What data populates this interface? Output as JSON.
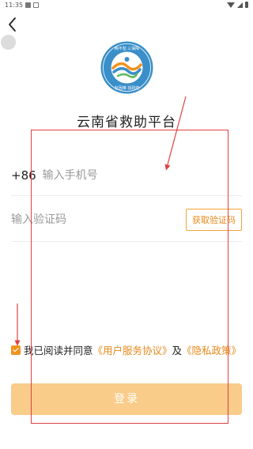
{
  "status_bar": {
    "time": "11:35"
  },
  "app": {
    "title": "云南省救助平台",
    "logo_text": "有困难 找政府",
    "logo_top_text": "两不愁 三保障"
  },
  "login_form": {
    "country_code": "+86",
    "phone_placeholder": "输入手机号",
    "code_placeholder": "输入验证码",
    "get_code_label": "获取验证码",
    "agreement_prefix": "我已阅读并同意",
    "user_agreement_link": "《用户服务协议》",
    "agreement_and": "及",
    "privacy_link": "《隐私政策》",
    "agreement_checked": true,
    "login_label": "登录"
  },
  "colors": {
    "accent": "#e8891a",
    "login_button_bg": "#f9cc89",
    "logo_blue": "#3a8fc9",
    "annotation_red": "#e04040"
  },
  "icons": {
    "back": "back-arrow-icon",
    "check": "check-icon"
  }
}
